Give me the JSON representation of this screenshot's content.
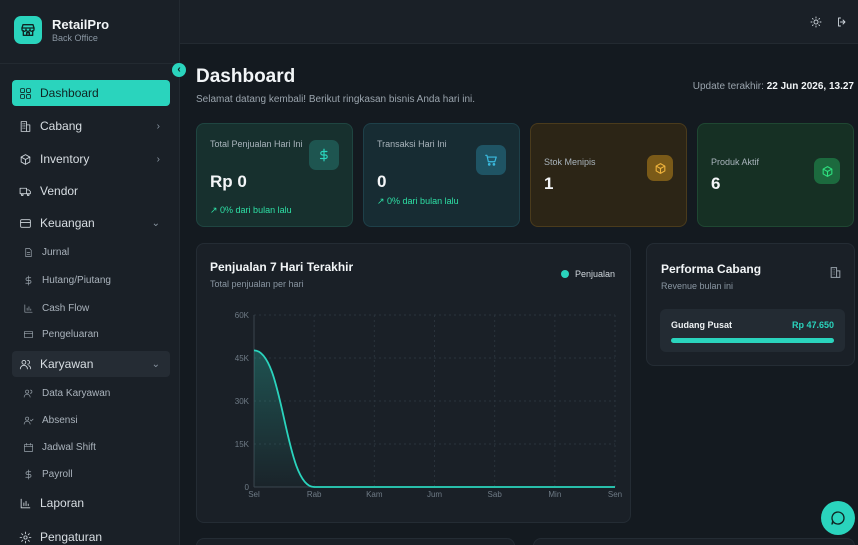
{
  "brand": {
    "name": "RetailPro",
    "subtitle": "Back Office"
  },
  "sidebar": {
    "items": [
      {
        "label": "Dashboard",
        "icon": "grid-icon",
        "active": true
      },
      {
        "label": "Cabang",
        "icon": "building-icon",
        "chevron": "›"
      },
      {
        "label": "Inventory",
        "icon": "package-icon",
        "chevron": "›"
      },
      {
        "label": "Vendor",
        "icon": "truck-icon"
      },
      {
        "label": "Keuangan",
        "icon": "wallet-icon",
        "chevron": "⌄"
      },
      {
        "label": "Karyawan",
        "icon": "users-icon",
        "chevron": "⌄",
        "open": true
      },
      {
        "label": "Laporan",
        "icon": "bar-chart-icon"
      },
      {
        "label": "Pengaturan",
        "icon": "gear-icon"
      }
    ],
    "keuangan_sub": [
      {
        "label": "Jurnal",
        "icon": "file-icon"
      },
      {
        "label": "Hutang/Piutang",
        "icon": "dollar-icon"
      },
      {
        "label": "Cash Flow",
        "icon": "bar-chart-icon"
      },
      {
        "label": "Pengeluaran",
        "icon": "card-icon"
      }
    ],
    "karyawan_sub": [
      {
        "label": "Data Karyawan",
        "icon": "users-icon"
      },
      {
        "label": "Absensi",
        "icon": "user-check-icon"
      },
      {
        "label": "Jadwal Shift",
        "icon": "calendar-icon"
      },
      {
        "label": "Payroll",
        "icon": "dollar-icon"
      }
    ]
  },
  "header": {
    "title": "Dashboard",
    "subtitle": "Selamat datang kembali! Berikut ringkasan bisnis Anda hari ini.",
    "update_label": "Update terakhir:",
    "update_value": "22 Jun 2026, 13.27"
  },
  "stats": [
    {
      "label": "Total Penjualan Hari Ini",
      "value": "Rp 0",
      "trend": "↗ 0% dari bulan lalu",
      "icon": "dollar-icon",
      "color": "#2ad4bd"
    },
    {
      "label": "Transaksi Hari Ini",
      "value": "0",
      "trend": "↗ 0% dari bulan lalu",
      "icon": "cart-icon",
      "color": "#3bbbe0"
    },
    {
      "label": "Stok Menipis",
      "value": "1",
      "icon": "package-icon",
      "color": "#f0b43c"
    },
    {
      "label": "Produk Aktif",
      "value": "6",
      "icon": "package-icon",
      "color": "#2ee07f"
    }
  ],
  "sales_chart": {
    "title": "Penjualan 7 Hari Terakhir",
    "subtitle": "Total penjualan per hari",
    "legend": "Penjualan"
  },
  "chart_data": {
    "type": "area",
    "title": "Penjualan 7 Hari Terakhir",
    "subtitle": "Total penjualan per hari",
    "categories": [
      "Sel",
      "Rab",
      "Kam",
      "Jum",
      "Sab",
      "Min",
      "Sen"
    ],
    "series": [
      {
        "name": "Penjualan",
        "values": [
          47650,
          0,
          0,
          0,
          0,
          0,
          0
        ]
      }
    ],
    "y_ticks": [
      "0",
      "15K",
      "30K",
      "45K",
      "60K"
    ],
    "ylim": [
      0,
      60000
    ],
    "grid": true,
    "legend_position": "top-right",
    "color": "#2ad4bd"
  },
  "performance": {
    "title": "Performa Cabang",
    "subtitle": "Revenue bulan ini",
    "branches": [
      {
        "name": "Gudang Pusat",
        "amount": "Rp 47.650",
        "fraction": 1.0
      }
    ]
  }
}
